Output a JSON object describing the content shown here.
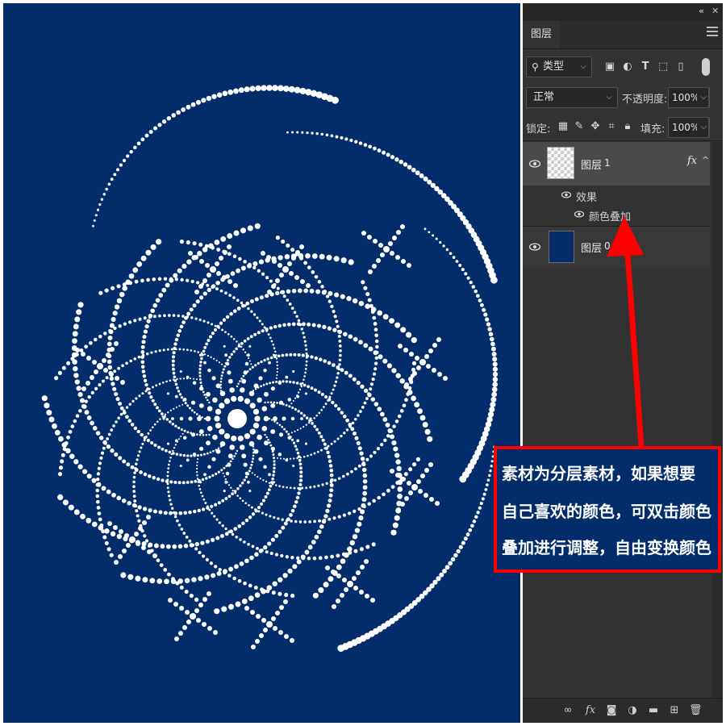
{
  "panel": {
    "tab_label": "图层",
    "filter_kind": "类型",
    "blend_mode": "正常",
    "opacity_label": "不透明度:",
    "opacity_value": "100%",
    "lock_label": "锁定:",
    "fill_label": "填充:",
    "fill_value": "100%",
    "layers": [
      {
        "name": "图层",
        "index": "1",
        "fx": "fx",
        "effects_label": "效果",
        "effect_item": "颜色叠加"
      },
      {
        "name": "图层",
        "index": "0"
      }
    ],
    "bottom_fx": "fx"
  },
  "callout": {
    "lines": [
      "素材为分层素材，如果想要",
      "自己喜欢的颜色，可双击颜色",
      "叠加进行调整，自由变换颜色"
    ]
  },
  "colors": {
    "canvas_bg": "#022d6a",
    "dot": "#ffffff",
    "panel_bg": "#323232",
    "highlight": "#ff0000"
  },
  "icons": {
    "filter": "search-icon",
    "eye": "eye-icon",
    "lock": "lock-icon"
  }
}
